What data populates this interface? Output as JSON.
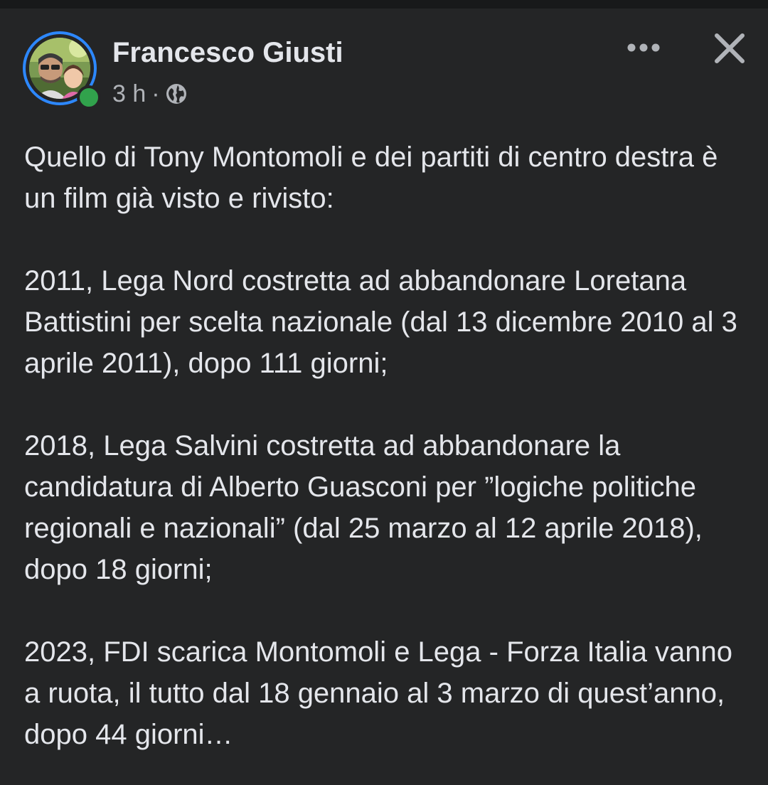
{
  "post": {
    "author": "Francesco Giusti",
    "time": "3 h",
    "separator": "·",
    "audience_icon": "globe-icon",
    "more_icon": "ellipsis-icon",
    "close_icon": "close-icon",
    "paragraphs": [
      "Quello di Tony Montomoli e dei partiti di centro destra è un film già visto e rivisto:",
      "2011, Lega Nord costretta ad abbandonare Loretana Battistini per scelta nazionale (dal 13 dicembre 2010 al 3 aprile 2011), dopo 111 giorni;",
      "2018, Lega Salvini costretta ad abbandonare la candidatura di Alberto Guasconi per ”logiche politiche regionali e nazionali” (dal 25 marzo al 12 aprile 2018), dopo 18 giorni;",
      "2023, FDI scarica Montomoli e Lega - Forza Italia vanno a ruota, il tutto dal 18 gennaio al 3 marzo di quest’anno, dopo 44 giorni…"
    ]
  },
  "colors": {
    "background": "#242526",
    "text_primary": "#e4e6eb",
    "text_secondary": "#b0b3b8",
    "story_ring": "#2d88ff",
    "online": "#31a24c"
  }
}
